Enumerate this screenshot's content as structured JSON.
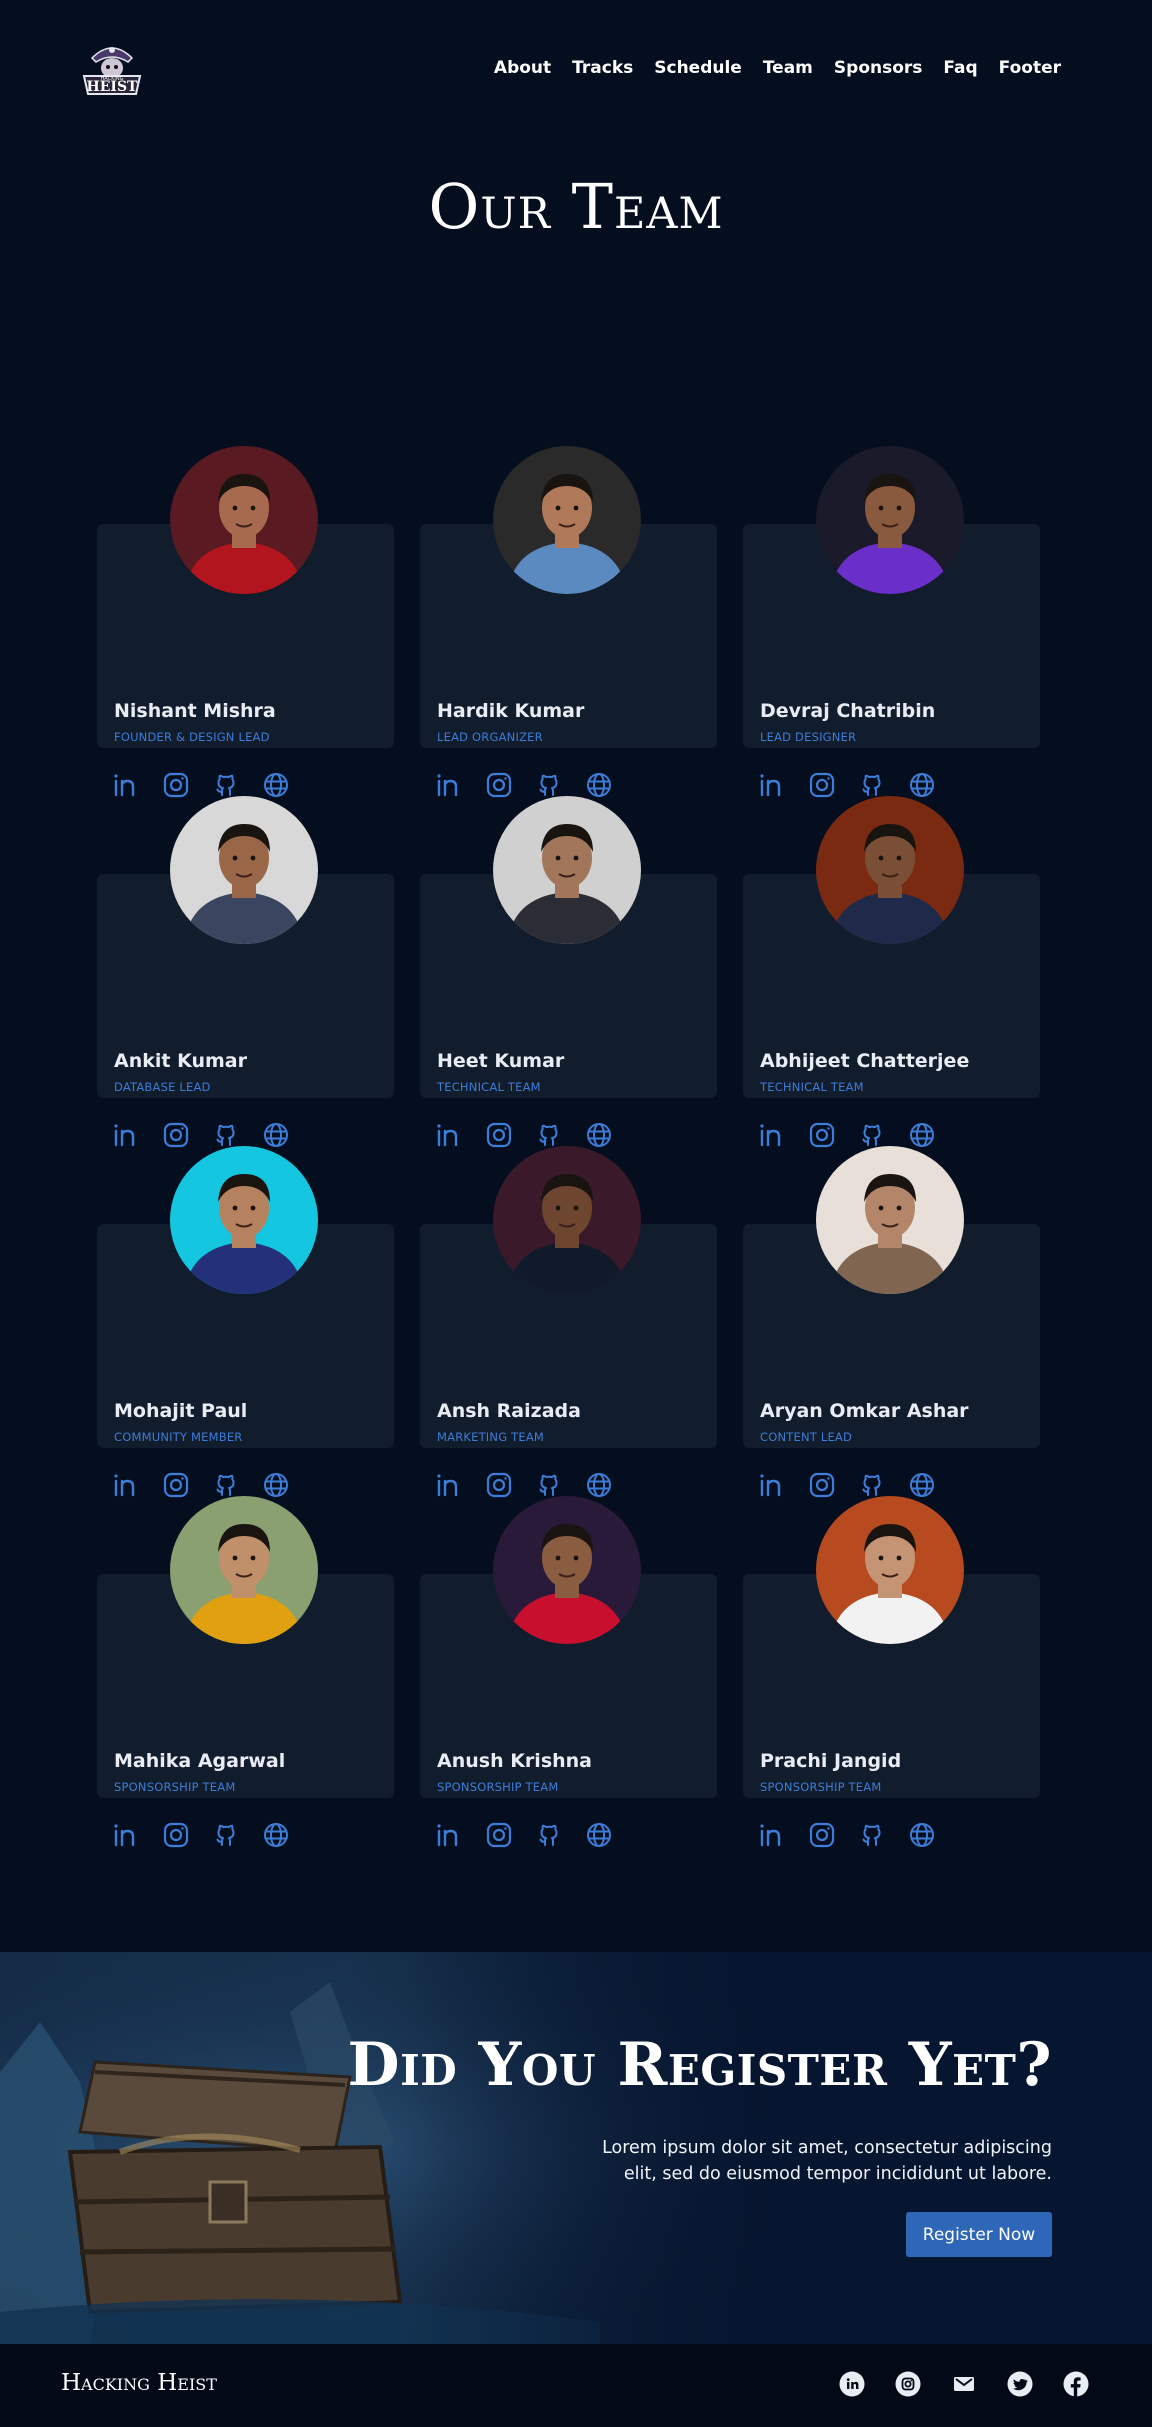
{
  "nav": {
    "items": [
      {
        "label": "About"
      },
      {
        "label": "Tracks"
      },
      {
        "label": "Schedule"
      },
      {
        "label": "Team"
      },
      {
        "label": "Sponsors"
      },
      {
        "label": "Faq"
      },
      {
        "label": "Footer"
      }
    ]
  },
  "page": {
    "title": "Our Team"
  },
  "team": [
    {
      "name": "Nishant Mishra",
      "role": "FOUNDER & DESIGN LEAD"
    },
    {
      "name": "Hardik Kumar",
      "role": "LEAD ORGANIZER"
    },
    {
      "name": "Devraj Chatribin",
      "role": "LEAD DESIGNER"
    },
    {
      "name": "Ankit Kumar",
      "role": "DATABASE LEAD"
    },
    {
      "name": "Heet Kumar",
      "role": "TECHNICAL TEAM"
    },
    {
      "name": "Abhijeet Chatterjee",
      "role": "TECHNICAL TEAM"
    },
    {
      "name": "Mohajit Paul",
      "role": "COMMUNITY MEMBER"
    },
    {
      "name": "Ansh Raizada",
      "role": "MARKETING TEAM"
    },
    {
      "name": "Aryan Omkar Ashar",
      "role": "CONTENT LEAD"
    },
    {
      "name": "Mahika Agarwal",
      "role": "SPONSORSHIP TEAM"
    },
    {
      "name": "Anush Krishna",
      "role": "SPONSORSHIP TEAM"
    },
    {
      "name": "Prachi Jangid",
      "role": "SPONSORSHIP TEAM"
    }
  ],
  "member_social_icons": [
    "linkedin-icon",
    "instagram-icon",
    "github-icon",
    "globe-icon"
  ],
  "cta": {
    "title": "Did You Register Yet?",
    "text": "Lorem ipsum dolor sit amet, consectetur adipiscing elit, sed do eiusmod tempor incididunt ut labore.",
    "button_label": "Register Now"
  },
  "footer": {
    "brand": "Hacking Heist",
    "social_icons": [
      "linkedin-icon",
      "instagram-icon",
      "mail-icon",
      "twitter-icon",
      "facebook-icon"
    ]
  },
  "colors": {
    "background": "#050e1f",
    "card": "#111c2c",
    "accent": "#3d7dd8",
    "button": "#2e67b8",
    "footer": "#030a17"
  }
}
